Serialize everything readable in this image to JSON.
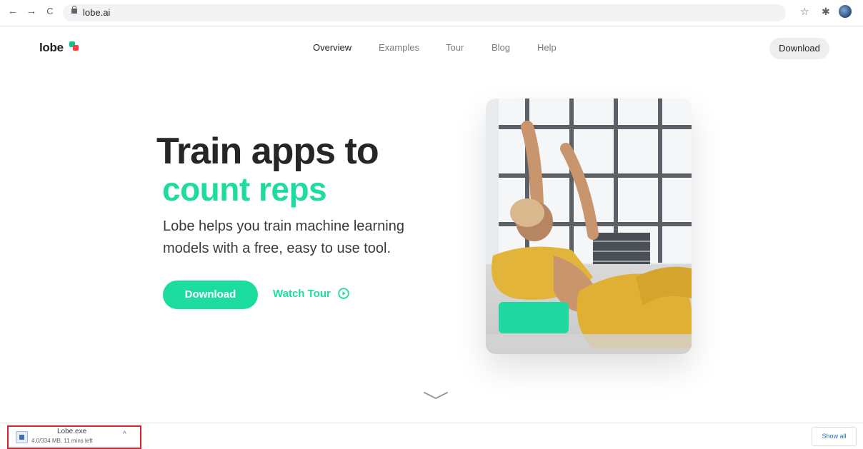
{
  "browser": {
    "url": "lobe.ai",
    "back_icon": "←",
    "forward_icon": "→",
    "reload_icon": "C",
    "star_icon": "☆",
    "extensions_icon": "✱",
    "more_icon": "⋮"
  },
  "site": {
    "logo": "lobe",
    "nav": [
      "Overview",
      "Examples",
      "Tour",
      "Blog",
      "Help"
    ],
    "header_download": "Download"
  },
  "hero": {
    "title_line1": "Train apps to",
    "title_line2": "count reps",
    "subtitle": "Lobe helps you train machine learning models with a free, easy to use tool.",
    "download_label": "Download",
    "watch_tour_label": "Watch Tour"
  },
  "download_shelf": {
    "file_name": "Lobe.exe",
    "status": "4.0/334 MB, 11 mins left",
    "show_all": "Show all"
  },
  "colors": {
    "accent": "#1ddc9f",
    "logo_red": "#ff3b3b",
    "highlight_border": "#d8202f"
  }
}
